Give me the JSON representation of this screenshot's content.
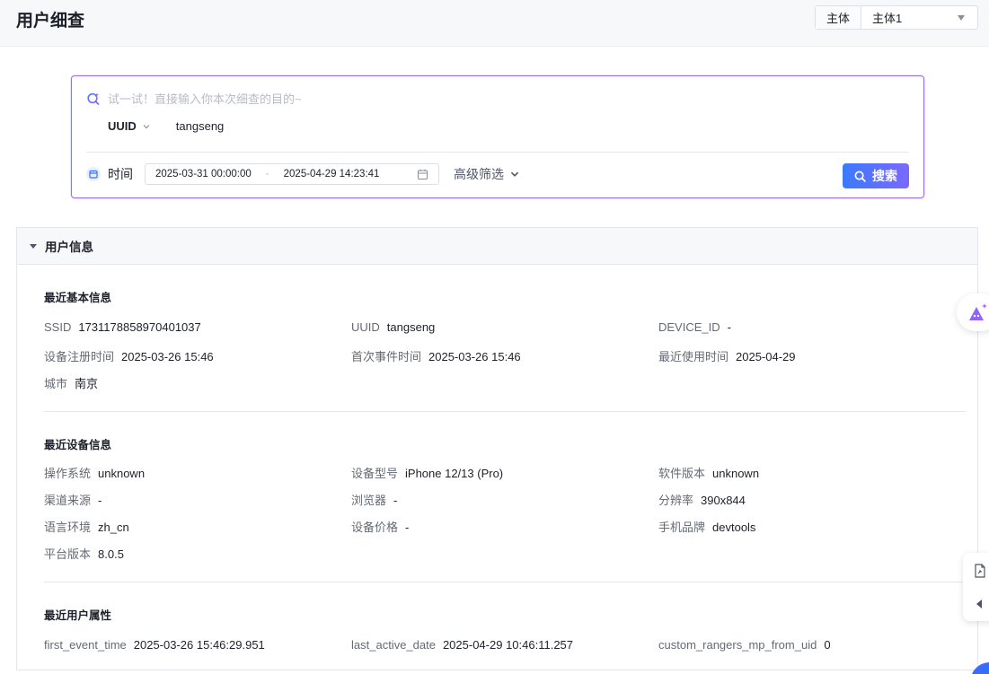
{
  "header": {
    "title": "用户细查",
    "entity_label": "主体",
    "entity_value": "主体1"
  },
  "search": {
    "ai_placeholder": "试一试！直接输入你本次细查的目的~",
    "id_type": "UUID",
    "id_value": "tangseng",
    "time_label": "时间",
    "start_time": "2025-03-31 00:00:00",
    "range_sep": "-",
    "end_time": "2025-04-29 14:23:41",
    "advanced_filter": "高级筛选",
    "search_button": "搜索"
  },
  "user_info": {
    "title": "用户信息",
    "basic": {
      "title": "最近基本信息",
      "fields": [
        {
          "k": "SSID",
          "v": "1731178858970401037"
        },
        {
          "k": "UUID",
          "v": "tangseng"
        },
        {
          "k": "DEVICE_ID",
          "v": "-"
        },
        {
          "k": "设备注册时间",
          "v": "2025-03-26 15:46"
        },
        {
          "k": "首次事件时间",
          "v": "2025-03-26 15:46"
        },
        {
          "k": "最近使用时间",
          "v": "2025-04-29"
        },
        {
          "k": "城市",
          "v": "南京"
        }
      ]
    },
    "device": {
      "title": "最近设备信息",
      "fields": [
        {
          "k": "操作系统",
          "v": "unknown"
        },
        {
          "k": "设备型号",
          "v": "iPhone 12/13 (Pro)"
        },
        {
          "k": "软件版本",
          "v": "unknown"
        },
        {
          "k": "渠道来源",
          "v": "-"
        },
        {
          "k": "浏览器",
          "v": "-"
        },
        {
          "k": "分辨率",
          "v": "390x844"
        },
        {
          "k": "语言环境",
          "v": "zh_cn"
        },
        {
          "k": "设备价格",
          "v": "-"
        },
        {
          "k": "手机品牌",
          "v": "devtools"
        },
        {
          "k": "平台版本",
          "v": "8.0.5"
        }
      ]
    },
    "attributes": {
      "title": "最近用户属性",
      "fields": [
        {
          "k": "first_event_time",
          "v": "2025-03-26 15:46:29.951"
        },
        {
          "k": "last_active_date",
          "v": "2025-04-29 10:46:11.257"
        },
        {
          "k": "custom_rangers_mp_from_uid",
          "v": "0"
        }
      ]
    }
  },
  "colors": {
    "accent_blue": "#3a7bff",
    "accent_purple": "#7c68ff",
    "card_border": "#9a6bff"
  }
}
